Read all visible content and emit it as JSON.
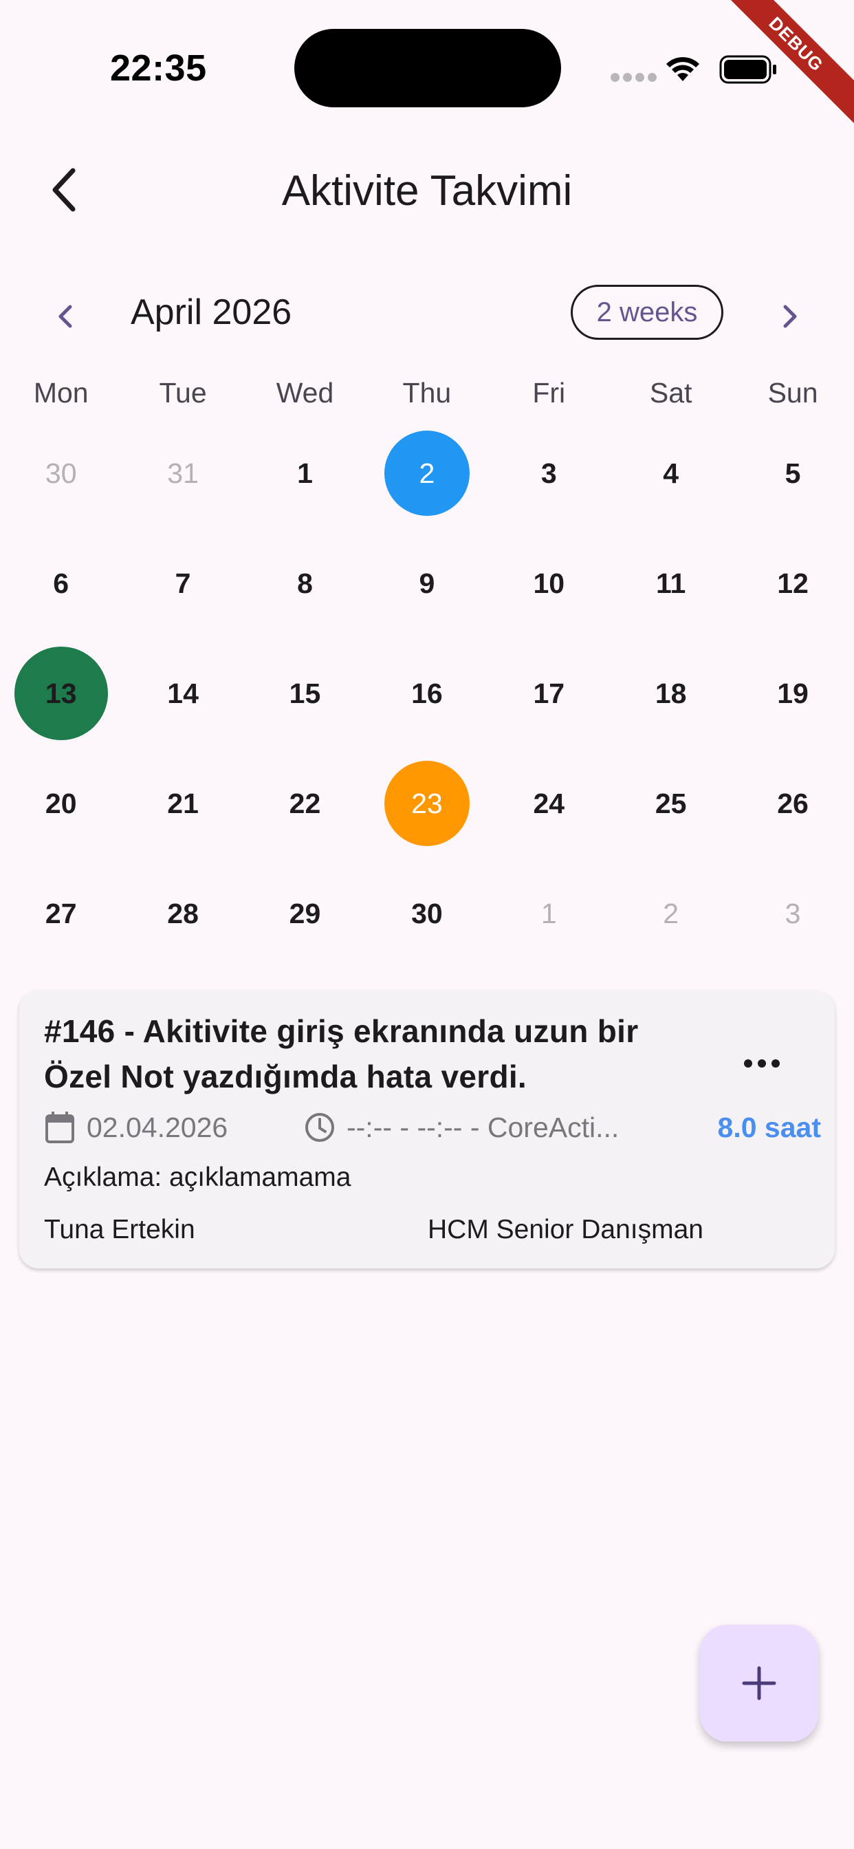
{
  "status_bar": {
    "time": "22:35",
    "debug_label": "DEBUG"
  },
  "app_bar": {
    "title": "Aktivite Takvimi"
  },
  "calendar": {
    "month_label": "April 2026",
    "format_button": "2 weeks",
    "weekdays": [
      "Mon",
      "Tue",
      "Wed",
      "Thu",
      "Fri",
      "Sat",
      "Sun"
    ],
    "weeks": [
      [
        "30",
        "31",
        "1",
        "2",
        "3",
        "4",
        "5"
      ],
      [
        "6",
        "7",
        "8",
        "9",
        "10",
        "11",
        "12"
      ],
      [
        "13",
        "14",
        "15",
        "16",
        "17",
        "18",
        "19"
      ],
      [
        "20",
        "21",
        "22",
        "23",
        "24",
        "25",
        "26"
      ],
      [
        "27",
        "28",
        "29",
        "30",
        "1",
        "2",
        "3"
      ]
    ],
    "selected_color": "#2196f3",
    "today_color": "#1e7b4b",
    "event_color": "#ff9800"
  },
  "activity_card": {
    "title": "#146 - Akitivite giriş ekranında uzun bir Özel Not yazdığımda hata verdi.",
    "date": "02.04.2026",
    "time_range": "--:-- - --:-- - CoreActi...",
    "hours": "8.0 saat",
    "description": "Açıklama: açıklamamama",
    "person": "Tuna Ertekin",
    "role": "HCM Senior Danışman"
  },
  "icons": {
    "back": "arrow-back-icon",
    "prev": "chevron-left-icon",
    "next": "chevron-right-icon",
    "more": "more-horizontal-icon",
    "calendar": "calendar-icon",
    "clock": "clock-icon",
    "add": "add-icon"
  }
}
